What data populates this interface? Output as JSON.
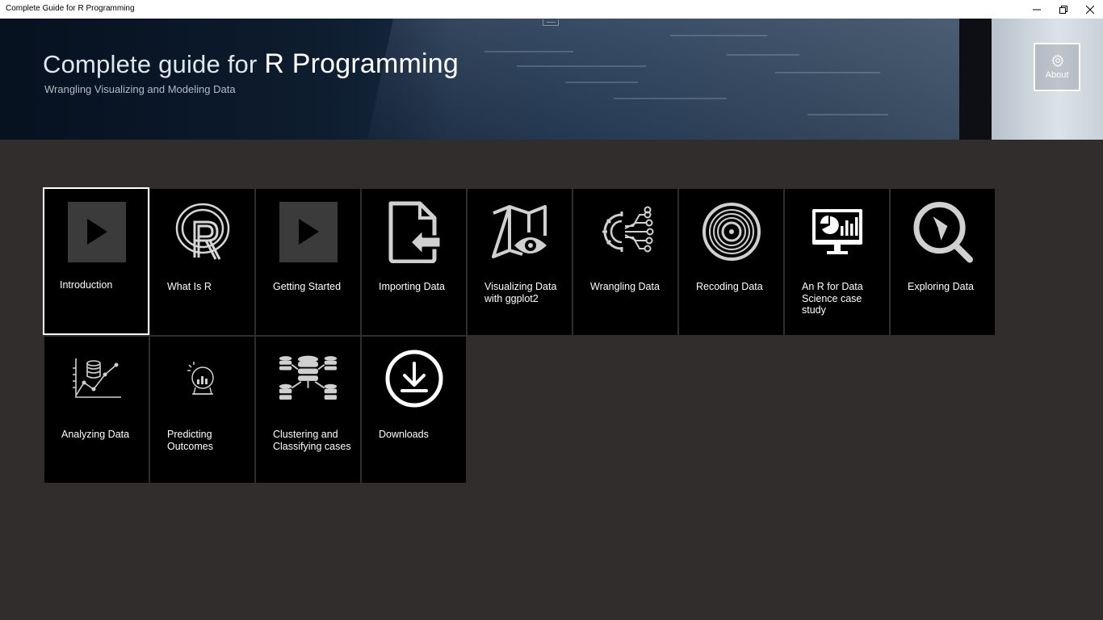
{
  "window": {
    "title": "Complete Guide for R Programming",
    "controls": [
      "minimize",
      "restore",
      "close"
    ]
  },
  "header": {
    "title_prefix": "Complete guide for ",
    "title_emphasis": "R Programming",
    "subtitle": "Wrangling Visualizing and Modeling Data",
    "about_label": "About",
    "about_icon": "gear-icon"
  },
  "tiles": [
    {
      "label": "Introduction",
      "icon": "play-icon",
      "selected": true
    },
    {
      "label": "What Is R",
      "icon": "r-logo-icon"
    },
    {
      "label": "Getting Started",
      "icon": "play-icon"
    },
    {
      "label": "Importing Data",
      "icon": "file-import-icon"
    },
    {
      "label": "Visualizing Data with ggplot2",
      "icon": "map-eye-icon"
    },
    {
      "label": "Wrangling Data",
      "icon": "gear-network-icon"
    },
    {
      "label": "Recoding Data",
      "icon": "vinyl-disc-icon"
    },
    {
      "label": "An R for Data Science case study",
      "icon": "monitor-chart-icon"
    },
    {
      "label": "Exploring Data",
      "icon": "compass-search-icon"
    },
    {
      "label": "Analyzing Data",
      "icon": "database-line-chart-icon"
    },
    {
      "label": "Predicting Outcomes",
      "icon": "crystal-ball-icon"
    },
    {
      "label": "Clustering and Classifying cases",
      "icon": "database-cluster-icon"
    },
    {
      "label": "Downloads",
      "icon": "download-icon"
    }
  ],
  "colors": {
    "background": "#322d2d",
    "tile": "#000000",
    "selected_border": "#ffffff",
    "icon_gray": "#d0d0d0"
  }
}
